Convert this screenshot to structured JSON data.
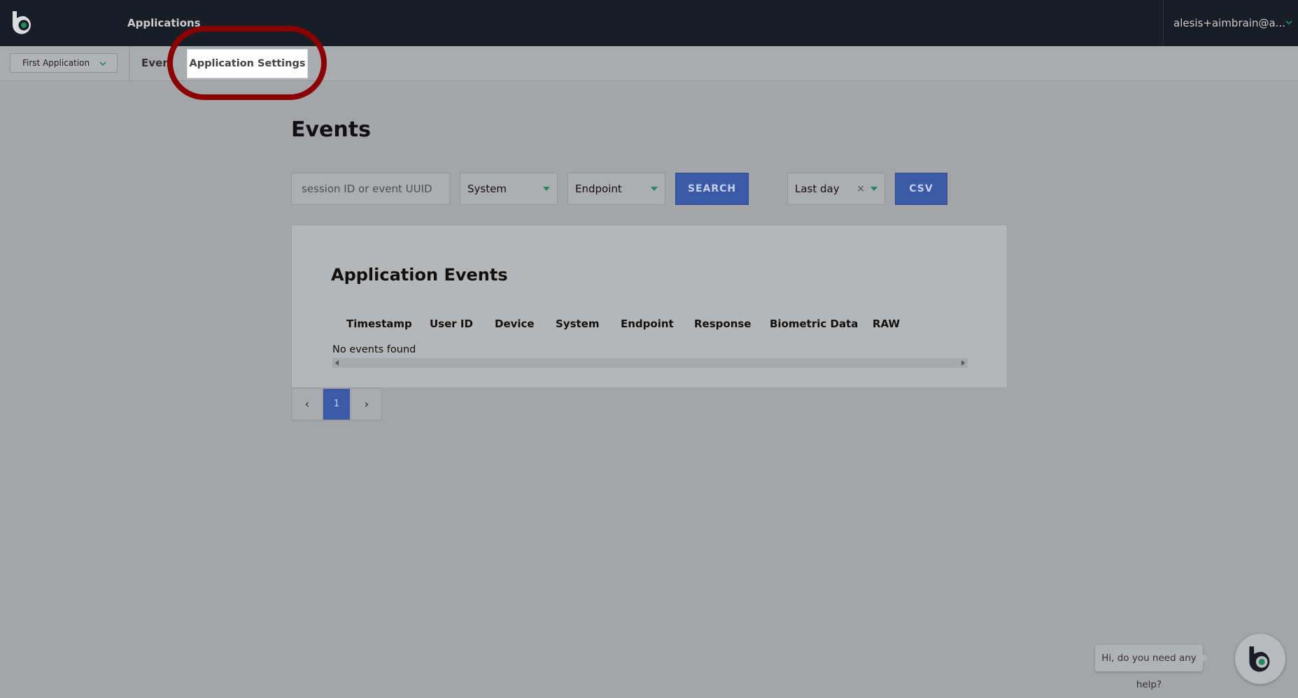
{
  "topbar": {
    "nav_label": "Applications",
    "user_email": "alesis+aimbrain@a..."
  },
  "subnav": {
    "app_selector": "First Application",
    "tab_events": "Even",
    "tab_settings": "Application Settings"
  },
  "page": {
    "title": "Events"
  },
  "filters": {
    "search_placeholder": "session ID or event UUID",
    "system_dropdown": "System",
    "endpoint_dropdown": "Endpoint",
    "search_button": "SEARCH",
    "range_dropdown": "Last day",
    "range_clear": "×",
    "csv_button": "CSV"
  },
  "events_table": {
    "title": "Application Events",
    "columns": [
      "Timestamp",
      "User ID",
      "Device",
      "System",
      "Endpoint",
      "Response",
      "Biometric Data",
      "RAW"
    ],
    "empty_message": "No events found"
  },
  "pagination": {
    "prev": "‹",
    "current": "1",
    "next": "›"
  },
  "help": {
    "message": "Hi, do you need any help?"
  },
  "colors": {
    "accent_blue": "#3a5aa8",
    "accent_green": "#1f8a5b",
    "topbar": "#181d26",
    "highlight": "#8b0000"
  },
  "icons": [
    "brand-logo-icon",
    "chevron-down-icon",
    "caret-down-icon",
    "chevron-left-icon",
    "chevron-right-icon",
    "clear-icon"
  ]
}
